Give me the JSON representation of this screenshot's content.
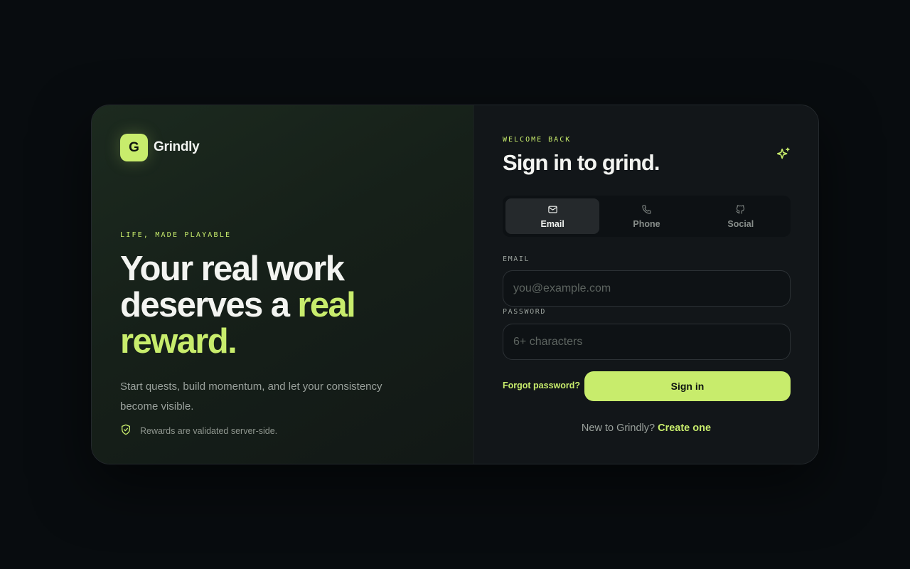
{
  "brand": {
    "logo_letter": "G",
    "name": "Grindly",
    "accent_color": "#c8ec6c"
  },
  "hero": {
    "eyebrow": "LIFE, MADE PLAYABLE",
    "headline_part1": "Your real work deserves a ",
    "headline_accent": "real reward.",
    "subtext": "Start quests, build momentum, and let your consistency become visible.",
    "note": "Rewards are validated server-side.",
    "note_icon": "shield-check-icon"
  },
  "signin": {
    "eyebrow": "WELCOME BACK",
    "title": "Sign in to grind.",
    "title_icon": "sparkle-icon",
    "tabs": [
      {
        "label": "Email",
        "icon": "mail-icon",
        "active": true
      },
      {
        "label": "Phone",
        "icon": "phone-icon",
        "active": false
      },
      {
        "label": "Social",
        "icon": "github-icon",
        "active": false
      }
    ],
    "email": {
      "label": "EMAIL",
      "value": "",
      "placeholder": "you@example.com"
    },
    "password": {
      "label": "PASSWORD",
      "value": "",
      "placeholder": "6+ characters"
    },
    "forgot_label": "Forgot password?",
    "submit_label": "Sign in",
    "create_prompt": "New to Grindly?",
    "create_link": "Create one"
  }
}
